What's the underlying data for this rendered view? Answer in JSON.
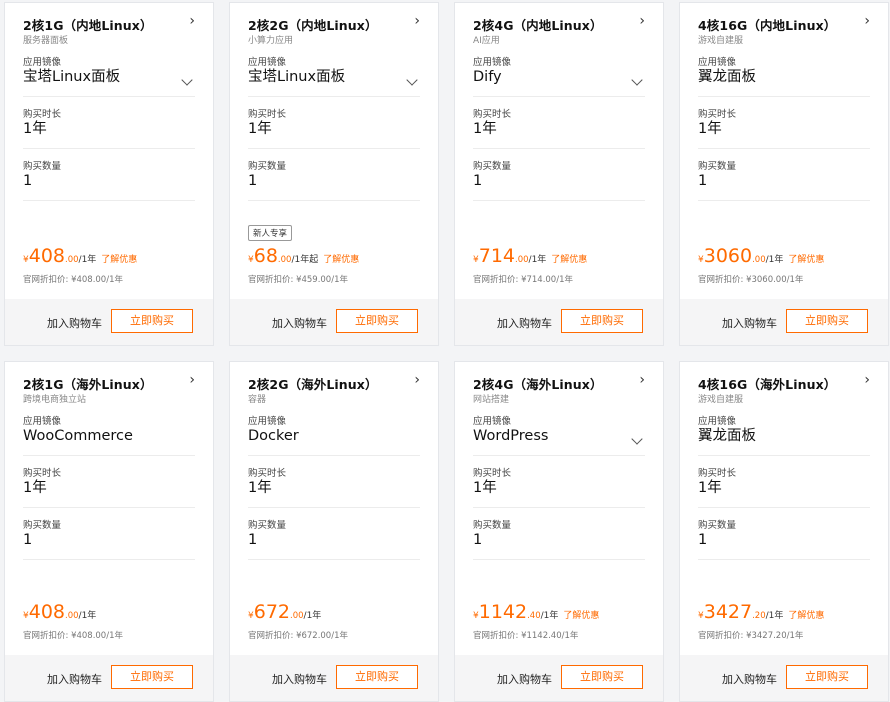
{
  "cards": [
    {
      "title": "2核1G（内地Linux）",
      "subtitle": "服务器面板",
      "image_label": "应用镜像",
      "image_value": "宝塔Linux面板",
      "image_dropdown": true,
      "duration_label": "购买时长",
      "duration_value": "1年",
      "quantity_label": "购买数量",
      "quantity_value": "1",
      "badge": "",
      "currency": "¥",
      "price_int": "408",
      "price_dec": ".00",
      "price_unit": "/1年",
      "promo": "了解优惠",
      "official_price": "官网折扣价: ¥408.00/1年",
      "cart_label": "加入购物车",
      "buy_label": "立即购买"
    },
    {
      "title": "2核2G（内地Linux）",
      "subtitle": "小算力应用",
      "image_label": "应用镜像",
      "image_value": "宝塔Linux面板",
      "image_dropdown": true,
      "duration_label": "购买时长",
      "duration_value": "1年",
      "quantity_label": "购买数量",
      "quantity_value": "1",
      "badge": "新人专享",
      "currency": "¥",
      "price_int": "68",
      "price_dec": ".00",
      "price_unit": "/1年起",
      "promo": "了解优惠",
      "official_price": "官网折扣价: ¥459.00/1年",
      "cart_label": "加入购物车",
      "buy_label": "立即购买"
    },
    {
      "title": "2核4G（内地Linux）",
      "subtitle": "AI应用",
      "image_label": "应用镜像",
      "image_value": "Dify",
      "image_dropdown": true,
      "duration_label": "购买时长",
      "duration_value": "1年",
      "quantity_label": "购买数量",
      "quantity_value": "1",
      "badge": "",
      "currency": "¥",
      "price_int": "714",
      "price_dec": ".00",
      "price_unit": "/1年",
      "promo": "了解优惠",
      "official_price": "官网折扣价: ¥714.00/1年",
      "cart_label": "加入购物车",
      "buy_label": "立即购买"
    },
    {
      "title": "4核16G（内地Linux）",
      "subtitle": "游戏自建服",
      "image_label": "应用镜像",
      "image_value": "翼龙面板",
      "image_dropdown": false,
      "duration_label": "购买时长",
      "duration_value": "1年",
      "quantity_label": "购买数量",
      "quantity_value": "1",
      "badge": "",
      "currency": "¥",
      "price_int": "3060",
      "price_dec": ".00",
      "price_unit": "/1年",
      "promo": "了解优惠",
      "official_price": "官网折扣价: ¥3060.00/1年",
      "cart_label": "加入购物车",
      "buy_label": "立即购买"
    },
    {
      "title": "2核1G（海外Linux）",
      "subtitle": "跨境电商独立站",
      "image_label": "应用镜像",
      "image_value": "WooCommerce",
      "image_dropdown": false,
      "duration_label": "购买时长",
      "duration_value": "1年",
      "quantity_label": "购买数量",
      "quantity_value": "1",
      "badge": "",
      "currency": "¥",
      "price_int": "408",
      "price_dec": ".00",
      "price_unit": "/1年",
      "promo": "",
      "official_price": "官网折扣价: ¥408.00/1年",
      "cart_label": "加入购物车",
      "buy_label": "立即购买"
    },
    {
      "title": "2核2G（海外Linux）",
      "subtitle": "容器",
      "image_label": "应用镜像",
      "image_value": "Docker",
      "image_dropdown": false,
      "duration_label": "购买时长",
      "duration_value": "1年",
      "quantity_label": "购买数量",
      "quantity_value": "1",
      "badge": "",
      "currency": "¥",
      "price_int": "672",
      "price_dec": ".00",
      "price_unit": "/1年",
      "promo": "",
      "official_price": "官网折扣价: ¥672.00/1年",
      "cart_label": "加入购物车",
      "buy_label": "立即购买"
    },
    {
      "title": "2核4G（海外Linux）",
      "subtitle": "网站搭建",
      "image_label": "应用镜像",
      "image_value": "WordPress",
      "image_dropdown": true,
      "duration_label": "购买时长",
      "duration_value": "1年",
      "quantity_label": "购买数量",
      "quantity_value": "1",
      "badge": "",
      "currency": "¥",
      "price_int": "1142",
      "price_dec": ".40",
      "price_unit": "/1年",
      "promo": "了解优惠",
      "official_price": "官网折扣价: ¥1142.40/1年",
      "cart_label": "加入购物车",
      "buy_label": "立即购买"
    },
    {
      "title": "4核16G（海外Linux）",
      "subtitle": "游戏自建服",
      "image_label": "应用镜像",
      "image_value": "翼龙面板",
      "image_dropdown": false,
      "duration_label": "购买时长",
      "duration_value": "1年",
      "quantity_label": "购买数量",
      "quantity_value": "1",
      "badge": "",
      "currency": "¥",
      "price_int": "3427",
      "price_dec": ".20",
      "price_unit": "/1年",
      "promo": "了解优惠",
      "official_price": "官网折扣价: ¥3427.20/1年",
      "cart_label": "加入购物车",
      "buy_label": "立即购买"
    }
  ],
  "colors": {
    "accent": "#ff6a00",
    "footer_bg": "#f5f5f6",
    "page_bg": "#f3f4f6"
  },
  "icons": {
    "title_arrow": "chevron-right-icon",
    "dropdown": "chevron-down-icon"
  }
}
